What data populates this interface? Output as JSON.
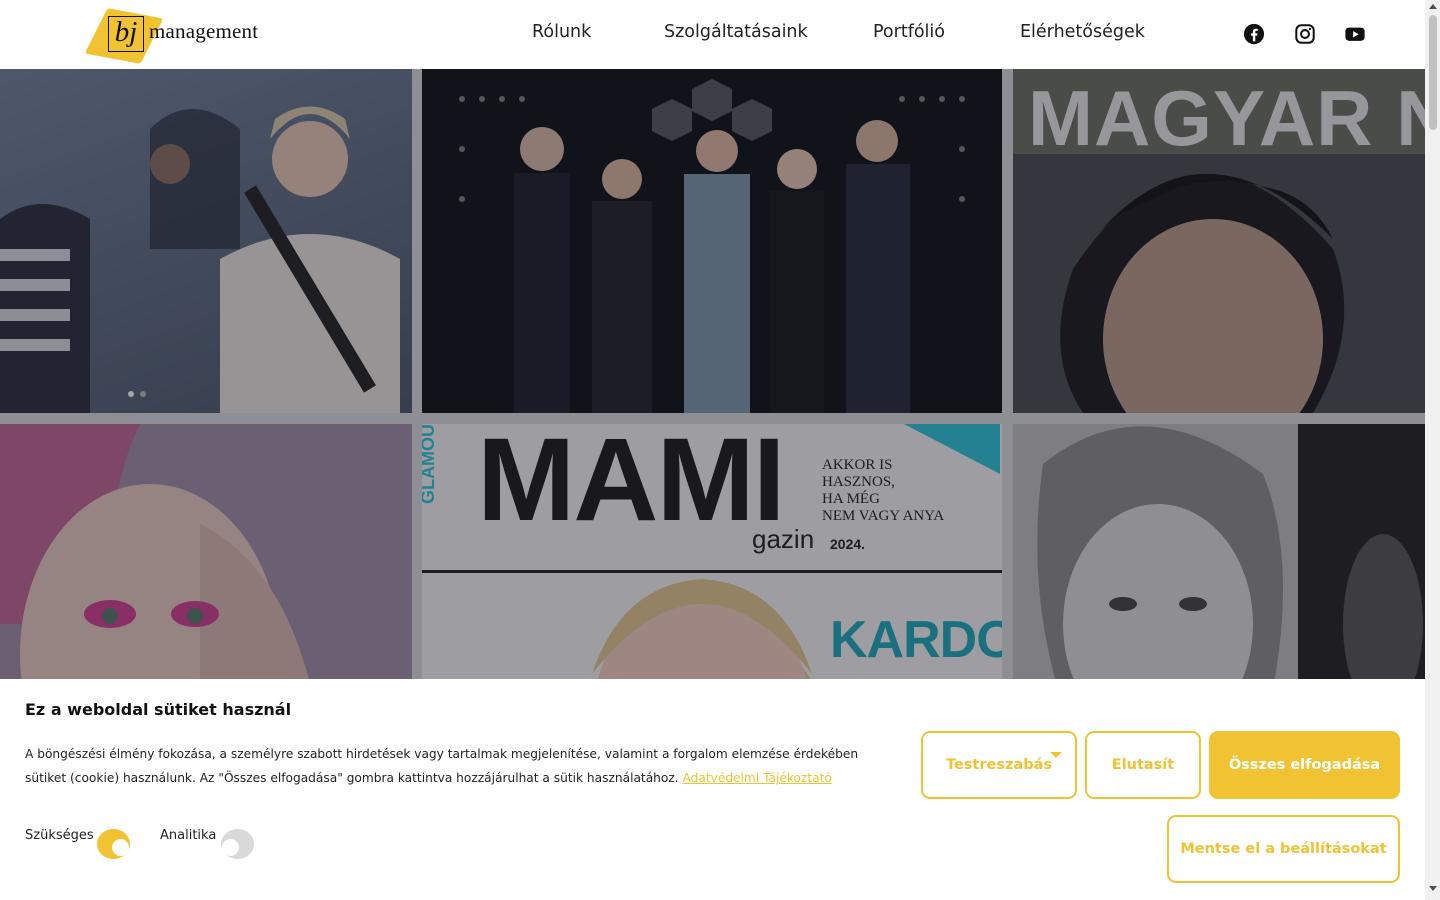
{
  "header": {
    "logo": {
      "mark": "bj",
      "word": "management"
    },
    "nav": [
      "Rólunk",
      "Szolgáltatásaink",
      "Portfólió",
      "Elérhetőségek"
    ],
    "social": [
      "facebook-icon",
      "instagram-icon",
      "youtube-icon"
    ]
  },
  "hero": {
    "tiles": [
      {
        "caption": ""
      },
      {
        "caption": ""
      },
      {
        "caption": "MAGYAR NAR"
      },
      {
        "caption": ""
      },
      {
        "caption": "MAMI",
        "sub1": "GLAMOUR",
        "sub2": "AKKOR IS",
        "sub3": "HASZNOS,",
        "sub4": "HA MÉG",
        "sub5": "NEM VAGY ANYA",
        "sub6": "KARDOS",
        "sub7": "gazin",
        "sub8": "2024."
      },
      {
        "caption": ""
      }
    ]
  },
  "cookie": {
    "title": "Ez a weboldal sütiket használ",
    "text": "A böngészési élmény fokozása, a személyre szabott hirdetések vagy tartalmak megjelenítése, valamint a forgalom elemzése érdekében sütiket (cookie) használunk. Az \"Összes elfogadása\" gombra kattintva hozzájárulhat a sütik használatához.",
    "privacy_link": "Adatvédelmi Tájékoztató",
    "toggles": [
      {
        "label": "Szükséges",
        "on": true
      },
      {
        "label": "Analitika",
        "on": false
      }
    ],
    "buttons": {
      "customize": "Testreszabás",
      "reject": "Elutasít",
      "accept_all": "Összes elfogadása",
      "save": "Mentse el a beállításokat"
    }
  },
  "colors": {
    "accent": "#f1c232",
    "text": "#222222",
    "toggle_off": "#d9d9d9"
  }
}
